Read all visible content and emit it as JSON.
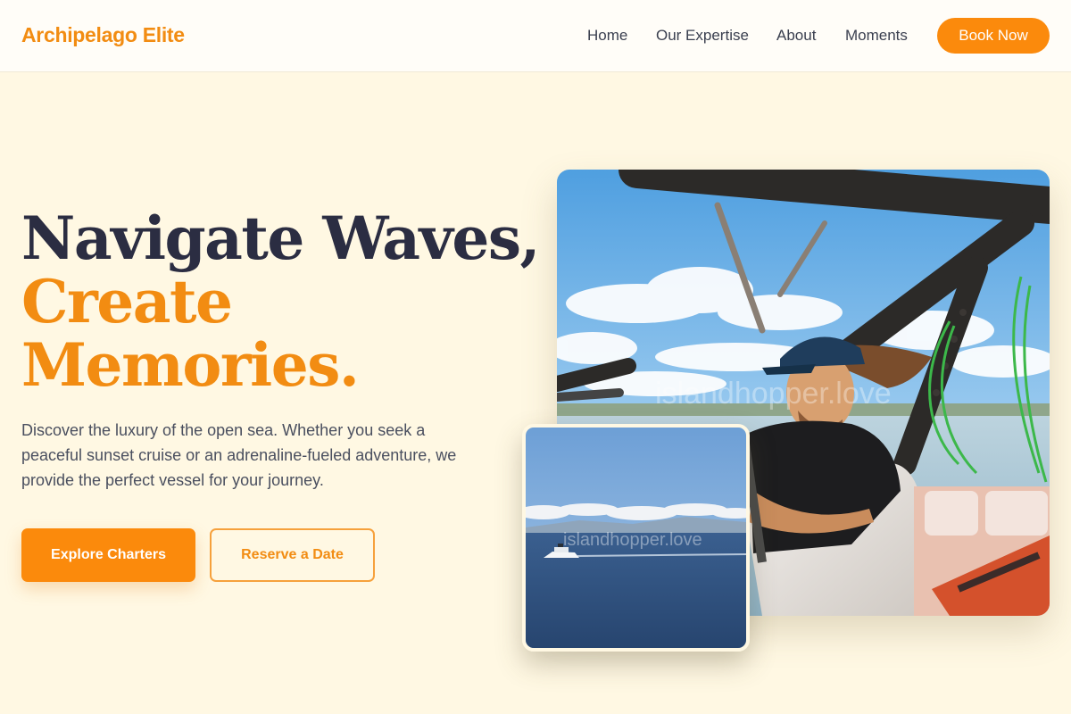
{
  "brand": {
    "name": "Archipelago Elite"
  },
  "nav": {
    "links": [
      {
        "label": "Home"
      },
      {
        "label": "Our Expertise"
      },
      {
        "label": "About"
      },
      {
        "label": "Moments"
      }
    ],
    "cta": "Book Now"
  },
  "hero": {
    "headline_line1": "Navigate Waves,",
    "headline_line2": "Create",
    "headline_line3": "Memories.",
    "description": "Discover the luxury of the open sea. Whether you seek a peaceful sunset cruise or an adrenaline-fueled adventure, we provide the perfect vessel for your journey.",
    "primary_button": "Explore Charters",
    "secondary_button": "Reserve a Date"
  },
  "images": {
    "main_watermark": "islandhopper.love",
    "small_watermark": "islandhopper.love"
  },
  "colors": {
    "accent": "#fb8a0c",
    "heading_dark": "#2b2d42",
    "background": "#fff8e3"
  }
}
